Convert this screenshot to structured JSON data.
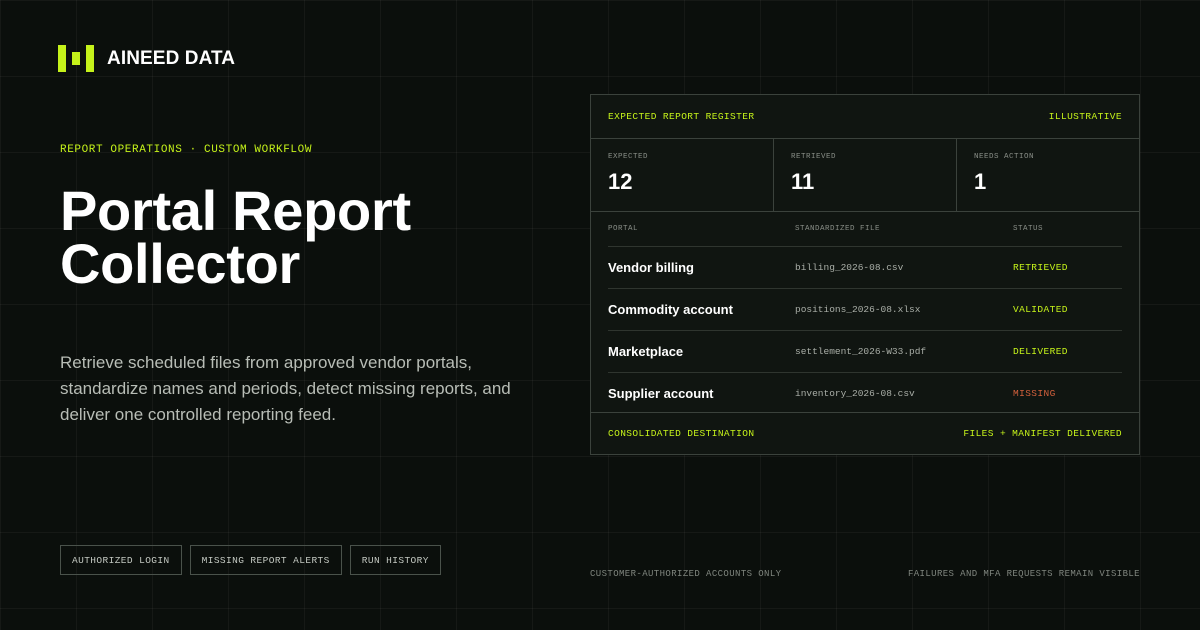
{
  "brand": {
    "name": "AINEED DATA",
    "accent_color": "#c5f21a",
    "logo_icon": "three-bar-logo-icon"
  },
  "hero": {
    "eyebrow": "REPORT OPERATIONS · CUSTOM WORKFLOW",
    "title_line_1": "Portal Report",
    "title_line_2": "Collector",
    "description": "Retrieve scheduled files from approved vendor portals, standardize names and periods, detect missing reports, and deliver one controlled reporting feed."
  },
  "tags": [
    "AUTHORIZED LOGIN",
    "MISSING REPORT ALERTS",
    "RUN HISTORY"
  ],
  "register": {
    "title": "EXPECTED REPORT REGISTER",
    "badge": "ILLUSTRATIVE",
    "stats": [
      {
        "label": "EXPECTED",
        "value": "12"
      },
      {
        "label": "RETRIEVED",
        "value": "11"
      },
      {
        "label": "NEEDS ACTION",
        "value": "1"
      }
    ],
    "columns": {
      "portal": "PORTAL",
      "file": "STANDARDIZED FILE",
      "status": "STATUS"
    },
    "rows": [
      {
        "portal": "Vendor billing",
        "file": "billing_2026-08.csv",
        "status": "RETRIEVED",
        "status_color": "#c5f21a"
      },
      {
        "portal": "Commodity account",
        "file": "positions_2026-08.xlsx",
        "status": "VALIDATED",
        "status_color": "#c5f21a"
      },
      {
        "portal": "Marketplace",
        "file": "settlement_2026-W33.pdf",
        "status": "DELIVERED",
        "status_color": "#c5f21a"
      },
      {
        "portal": "Supplier account",
        "file": "inventory_2026-08.csv",
        "status": "MISSING",
        "status_color": "#d2603c"
      }
    ],
    "footer_left": "CONSOLIDATED DESTINATION",
    "footer_right": "FILES + MANIFEST DELIVERED"
  },
  "notes": {
    "left": "CUSTOMER-AUTHORIZED ACCOUNTS ONLY",
    "right": "FAILURES AND MFA REQUESTS REMAIN VISIBLE"
  }
}
